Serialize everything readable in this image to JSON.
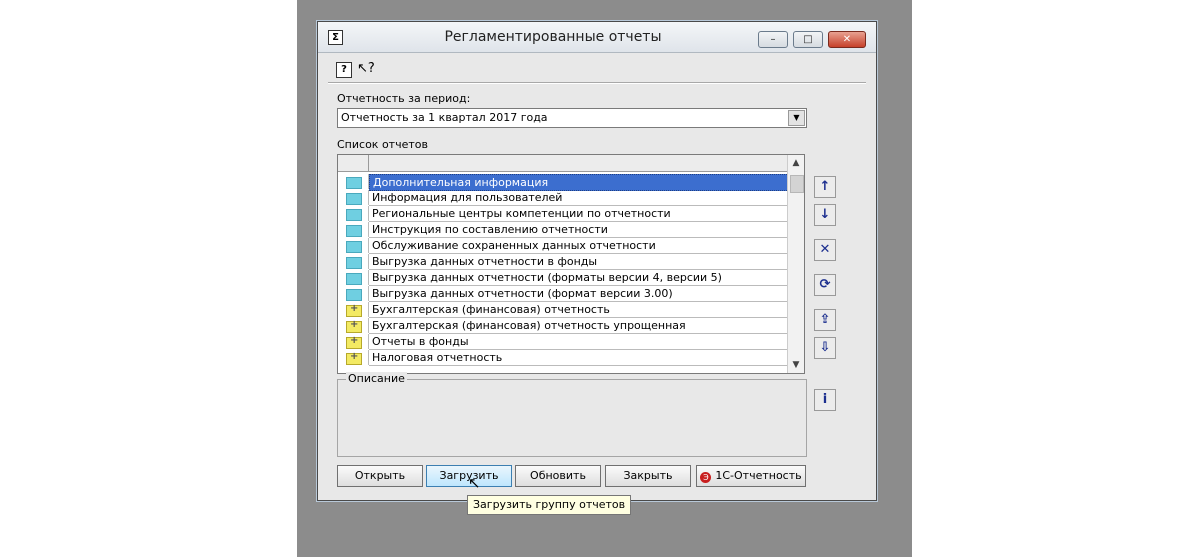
{
  "window": {
    "title": "Регламентированные отчеты",
    "app_icon_glyph": "Σ",
    "controls": {
      "minimize": "–",
      "maximize": "□",
      "close": "✕"
    }
  },
  "toolbar": {
    "help_glyph": "?",
    "whatis_glyph": "↖?"
  },
  "period": {
    "label": "Отчетность за период:",
    "value": "Отчетность за 1 квартал 2017 года"
  },
  "reports": {
    "label": "Список отчетов",
    "items": [
      {
        "label": "Дополнительная информация",
        "icon": "folder-icon",
        "selected": true
      },
      {
        "label": "Информация для пользователей",
        "icon": "folder-icon"
      },
      {
        "label": "Региональные центры компетенции по отчетности",
        "icon": "folder-icon"
      },
      {
        "label": "Инструкция по составлению отчетности",
        "icon": "folder-icon"
      },
      {
        "label": "Обслуживание сохраненных данных отчетности",
        "icon": "folder-icon"
      },
      {
        "label": "Выгрузка данных отчетности в фонды",
        "icon": "folder-icon"
      },
      {
        "label": "Выгрузка данных отчетности (форматы версии 4, версии 5)",
        "icon": "folder-icon"
      },
      {
        "label": "Выгрузка данных отчетности (формат версии 3.00)",
        "icon": "folder-icon"
      },
      {
        "label": "Бухгалтерская (финансовая) отчетность",
        "icon": "group-folder-icon"
      },
      {
        "label": "Бухгалтерская (финансовая) отчетность упрощенная",
        "icon": "group-folder-icon"
      },
      {
        "label": "Отчеты в фонды",
        "icon": "group-folder-icon"
      },
      {
        "label": "Налоговая отчетность",
        "icon": "group-folder-icon"
      }
    ]
  },
  "side_buttons": {
    "up": "↑",
    "down": "↓",
    "delete": "✕",
    "refresh": "⟳",
    "export": "⇪",
    "import": "⇩",
    "info": "i"
  },
  "description": {
    "label": "Описание"
  },
  "buttons": {
    "open": "Открыть",
    "load": "Загрузить",
    "update": "Обновить",
    "close": "Закрыть",
    "onec": "1С-Отчетность",
    "onec_logo": "Э"
  },
  "tooltip": "Загрузить группу отчетов",
  "cursor_glyph": "↖"
}
